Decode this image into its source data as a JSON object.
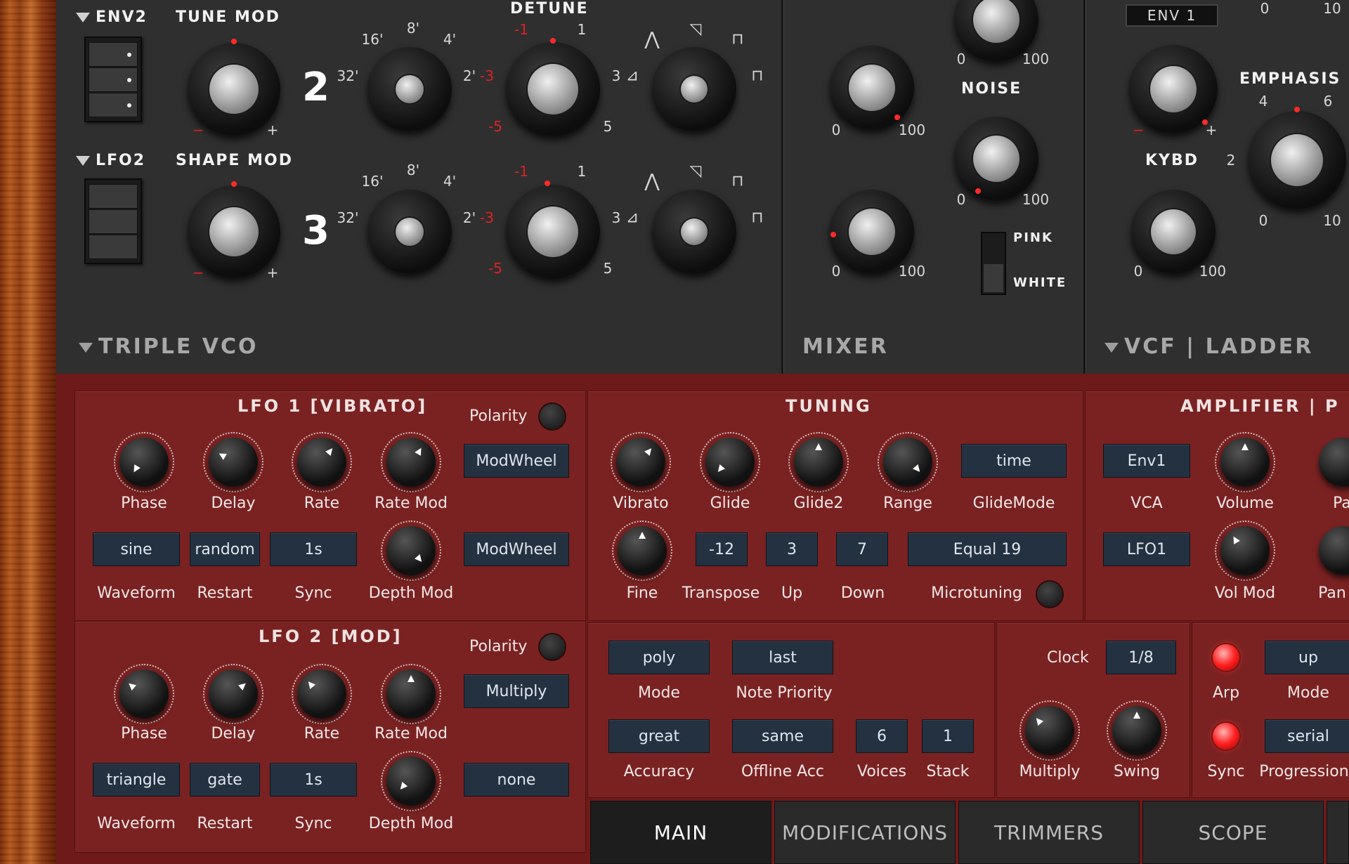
{
  "vco": {
    "env2": "ENV2",
    "tune_mod": "TUNE MOD",
    "lfo2": "LFO2",
    "shape_mod": "SHAPE MOD",
    "osc2": "2",
    "osc3": "3",
    "detune": "DETUNE",
    "section": "TRIPLE VCO",
    "octave": [
      "32'",
      "16'",
      "8'",
      "4'",
      "2'"
    ],
    "detune_marks": [
      "-1",
      "1",
      "-3",
      "3",
      "-5",
      "5"
    ],
    "plus": "+",
    "minus": "−"
  },
  "mixer": {
    "section": "MIXER",
    "noise": "NOISE",
    "pink": "PINK",
    "white": "WHITE",
    "min": "0",
    "max": "100"
  },
  "vcf": {
    "section": "VCF | LADDER",
    "env1": "ENV 1",
    "emphasis": "EMPHASIS",
    "kybd": "KYBD",
    "zero": "0",
    "ten": "10",
    "two": "2",
    "four": "4",
    "six": "6",
    "hundred": "100",
    "plus": "+",
    "minus": "−"
  },
  "lfo1": {
    "title": "LFO 1 [VIBRATO]",
    "polarity": "Polarity",
    "modwheel1": "ModWheel",
    "modwheel2": "ModWheel",
    "knobs": [
      "Phase",
      "Delay",
      "Rate",
      "Rate Mod"
    ],
    "waveform": "sine",
    "restart": "random",
    "sync": "1s",
    "labels": [
      "Waveform",
      "Restart",
      "Sync",
      "Depth Mod"
    ]
  },
  "lfo2p": {
    "title": "LFO 2 [MOD]",
    "polarity": "Polarity",
    "multiply": "Multiply",
    "none": "none",
    "knobs": [
      "Phase",
      "Delay",
      "Rate",
      "Rate Mod"
    ],
    "waveform": "triangle",
    "restart": "gate",
    "sync": "1s",
    "labels": [
      "Waveform",
      "Restart",
      "Sync",
      "Depth Mod"
    ]
  },
  "tuning": {
    "title": "TUNING",
    "knobs": [
      "Vibrato",
      "Glide",
      "Glide2",
      "Range"
    ],
    "glidemode_val": "time",
    "glidemode": "GlideMode",
    "fine": "Fine",
    "transpose_val": "-12",
    "transpose": "Transpose",
    "up_val": "3",
    "up": "Up",
    "down_val": "7",
    "down": "Down",
    "micro_val": "Equal 19",
    "micro": "Microtuning"
  },
  "amp": {
    "title": "AMPLIFIER | P",
    "vca_val": "Env1",
    "vca": "VCA",
    "volume": "Volume",
    "pa": "Pa",
    "lfo_val": "LFO1",
    "volmod": "Vol Mod",
    "pan": "Pan"
  },
  "voice": {
    "mode_val": "poly",
    "mode": "Mode",
    "prio_val": "last",
    "prio": "Note Priority",
    "acc_val": "great",
    "acc": "Accuracy",
    "off_val": "same",
    "off": "Offline Acc",
    "voices_val": "6",
    "voices": "Voices",
    "stack_val": "1",
    "stack": "Stack"
  },
  "clock": {
    "clock": "Clock",
    "clock_val": "1/8",
    "multiply": "Multiply",
    "swing": "Swing"
  },
  "arp": {
    "arp": "Arp",
    "mode_val": "up",
    "mode": "Mode",
    "sync": "Sync",
    "prog_val": "serial",
    "prog": "Progression"
  },
  "tabs": [
    "MAIN",
    "MODIFICATIONS",
    "TRIMMERS",
    "SCOPE"
  ],
  "colors": {
    "red_panel": "#7a2222",
    "dark_panel": "#2f2f2f",
    "button": "#243140",
    "led_on": "#ff2020"
  }
}
